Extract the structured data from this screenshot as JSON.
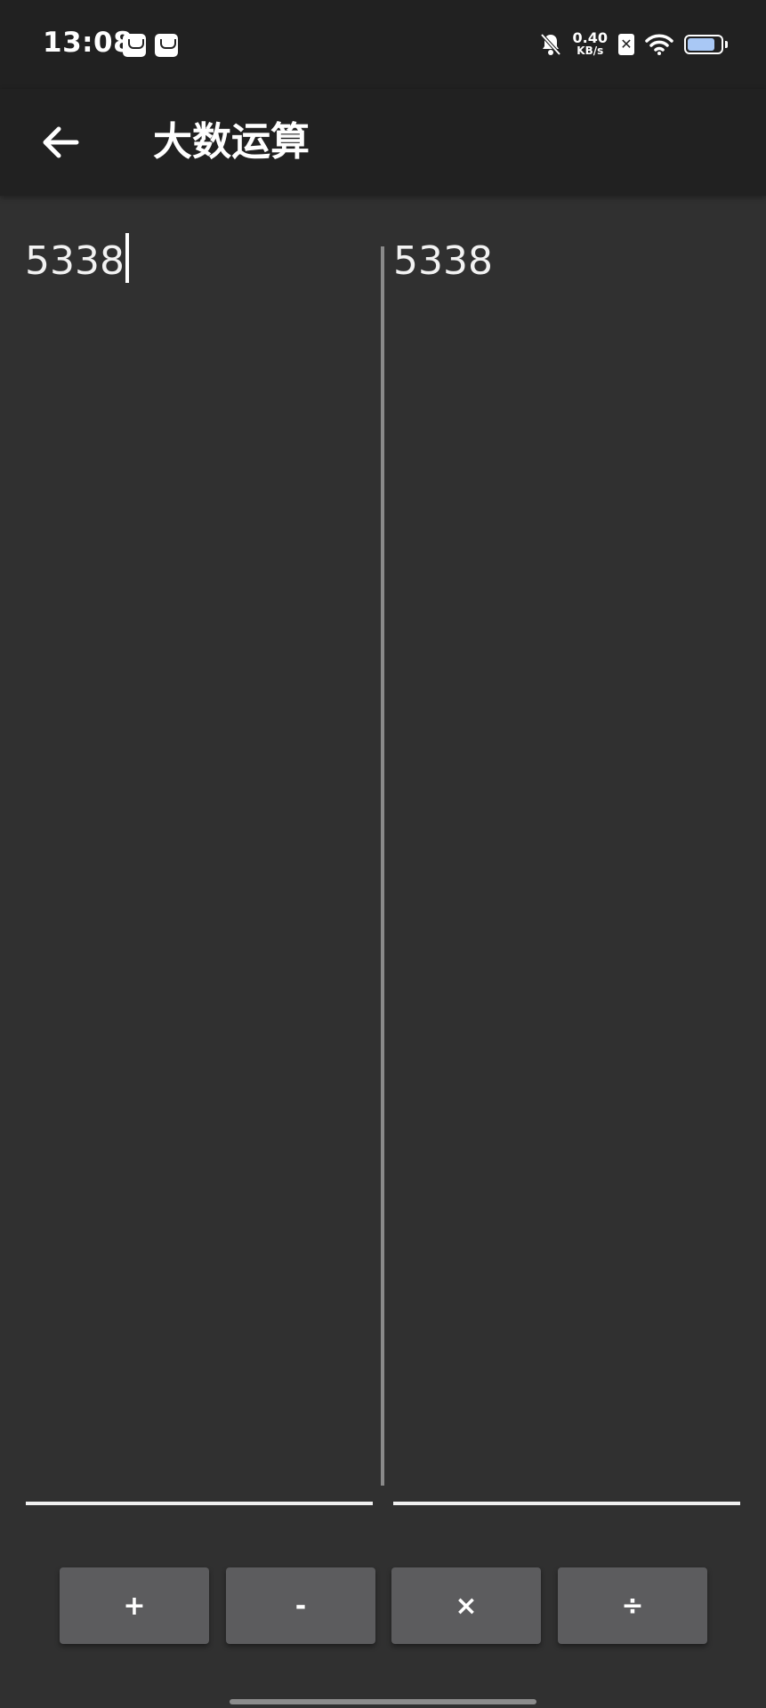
{
  "status_bar": {
    "time": "13:08",
    "net_speed_value": "0.40",
    "net_speed_unit": "KB/s",
    "battery_level": 0.85,
    "icons": [
      "notification-app-icon",
      "notification-mail-icon",
      "bell-muted-icon",
      "sim-missing-icon",
      "wifi-icon",
      "battery-icon"
    ]
  },
  "appbar": {
    "title": "大数运算",
    "back_icon": "arrow-left-icon"
  },
  "inputs": {
    "left_value": "5338",
    "right_value": "5338"
  },
  "operations": [
    {
      "label": "+"
    },
    {
      "label": "-"
    },
    {
      "label": "×"
    },
    {
      "label": "÷"
    }
  ],
  "colors": {
    "background": "#303030",
    "appbar": "#212121",
    "button": "#5c5c5e",
    "battery_fill": "#a9c8f5"
  }
}
